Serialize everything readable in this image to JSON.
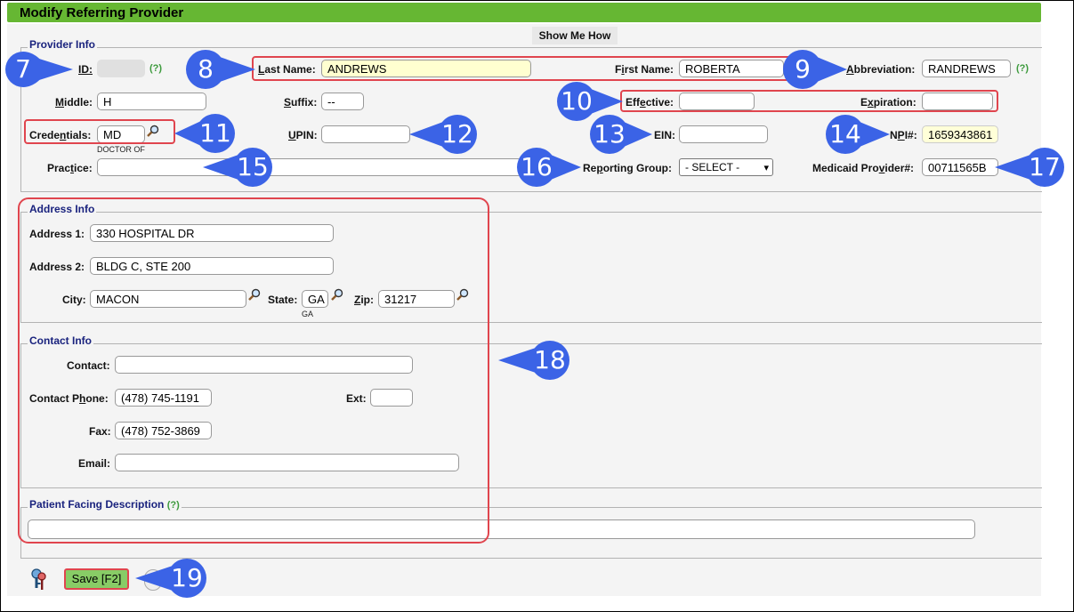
{
  "window": {
    "title": "Modify Referring Provider",
    "show_me_how": "Show Me How"
  },
  "provider_info": {
    "legend": "Provider Info",
    "id_label": "ID:",
    "id_value": "",
    "help": "(?)",
    "last_name_label": "Last Name:",
    "last_name_value": "ANDREWS",
    "first_name_label": "First Name:",
    "first_name_value": "ROBERTA",
    "abbreviation_label": "Abbreviation:",
    "abbreviation_value": "RANDREWS",
    "middle_label": "Middle:",
    "middle_value": "H",
    "suffix_label": "Suffix:",
    "suffix_value": "--",
    "effective_label": "Effective:",
    "effective_value": "",
    "expiration_label": "Expiration:",
    "expiration_value": "",
    "credentials_label": "Credentials:",
    "credentials_value": "MD",
    "credentials_desc": "DOCTOR OF",
    "upin_label": "UPIN:",
    "upin_value": "",
    "ein_label": "EIN:",
    "ein_value": "",
    "npi_label": "NPI#:",
    "npi_value": "1659343861",
    "practice_label": "Practice:",
    "practice_value": "",
    "reporting_group_label": "Reporting Group:",
    "reporting_group_value": "- SELECT -",
    "medicaid_label": "Medicaid Provider#:",
    "medicaid_value": "00711565B"
  },
  "address_info": {
    "legend": "Address Info",
    "address1_label": "Address 1:",
    "address1_value": "330 HOSPITAL DR",
    "address2_label": "Address 2:",
    "address2_value": "BLDG C, STE 200",
    "city_label": "City:",
    "city_value": "MACON",
    "state_label": "State:",
    "state_value": "GA",
    "state_desc": "GA",
    "zip_label": "Zip:",
    "zip_value": "31217"
  },
  "contact_info": {
    "legend": "Contact Info",
    "contact_label": "Contact:",
    "contact_value": "",
    "phone_label": "Contact Phone:",
    "phone_value": "(478) 745-1191",
    "ext_label": "Ext:",
    "ext_value": "",
    "fax_label": "Fax:",
    "fax_value": "(478) 752-3869",
    "email_label": "Email:",
    "email_value": ""
  },
  "patient_facing": {
    "legend": "Patient Facing Description",
    "help": "(?)",
    "value": ""
  },
  "footer": {
    "save_label": "Save [F2]"
  },
  "callouts": [
    "7",
    "8",
    "9",
    "10",
    "11",
    "12",
    "13",
    "14",
    "15",
    "16",
    "17",
    "18",
    "19"
  ],
  "colors": {
    "title_green": "#66b733",
    "callout_blue": "#3b63e6",
    "highlight_red": "#e0454e",
    "legend_navy": "#1a237e"
  }
}
